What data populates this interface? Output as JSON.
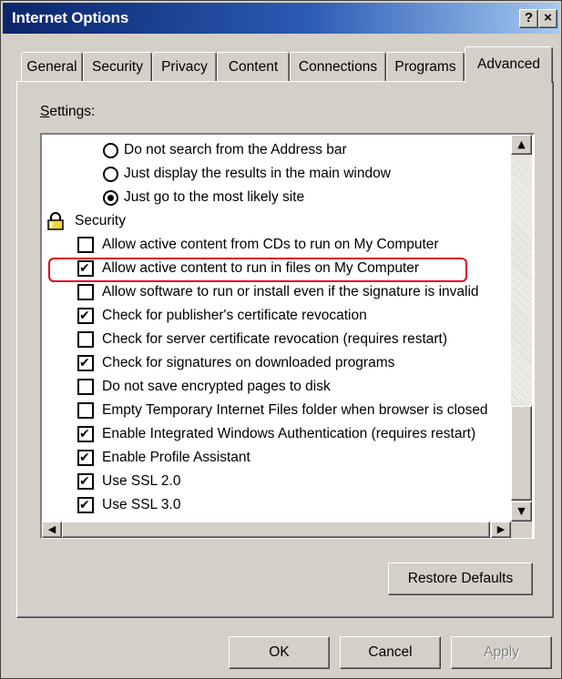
{
  "window": {
    "title": "Internet Options",
    "help_glyph": "?",
    "close_glyph": "×"
  },
  "tabs": [
    {
      "label": "General"
    },
    {
      "label": "Security"
    },
    {
      "label": "Privacy"
    },
    {
      "label": "Content"
    },
    {
      "label": "Connections"
    },
    {
      "label": "Programs"
    },
    {
      "label": "Advanced",
      "active": true
    }
  ],
  "settings": {
    "label": "Settings:",
    "items": [
      {
        "type": "radio",
        "checked": false,
        "label": "Do not search from the Address bar"
      },
      {
        "type": "radio",
        "checked": false,
        "label": "Just display the results in the main window"
      },
      {
        "type": "radio",
        "checked": true,
        "label": "Just go to the most likely site"
      },
      {
        "type": "group",
        "icon": "lock-icon",
        "label": "Security"
      },
      {
        "type": "checkbox",
        "checked": false,
        "label": "Allow active content from CDs to run on My Computer"
      },
      {
        "type": "checkbox",
        "checked": true,
        "label": "Allow active content to run in files on My Computer",
        "highlighted": true
      },
      {
        "type": "checkbox",
        "checked": false,
        "label": "Allow software to run or install even if the signature is invalid"
      },
      {
        "type": "checkbox",
        "checked": true,
        "label": "Check for publisher's certificate revocation"
      },
      {
        "type": "checkbox",
        "checked": false,
        "label": "Check for server certificate revocation (requires restart)"
      },
      {
        "type": "checkbox",
        "checked": true,
        "label": "Check for signatures on downloaded programs"
      },
      {
        "type": "checkbox",
        "checked": false,
        "label": "Do not save encrypted pages to disk"
      },
      {
        "type": "checkbox",
        "checked": false,
        "label": "Empty Temporary Internet Files folder when browser is closed"
      },
      {
        "type": "checkbox",
        "checked": true,
        "label": "Enable Integrated Windows Authentication (requires restart)"
      },
      {
        "type": "checkbox",
        "checked": true,
        "label": "Enable Profile Assistant"
      },
      {
        "type": "checkbox",
        "checked": true,
        "label": "Use SSL 2.0"
      },
      {
        "type": "checkbox",
        "checked": true,
        "label": "Use SSL 3.0"
      }
    ]
  },
  "buttons": {
    "restore_defaults": "Restore Defaults",
    "ok": "OK",
    "cancel": "Cancel",
    "apply": "Apply"
  },
  "colors": {
    "titlebar_start": "#0a246a",
    "titlebar_end": "#a6caf0",
    "highlight": "#e0001b",
    "face": "#d4d0c8"
  }
}
